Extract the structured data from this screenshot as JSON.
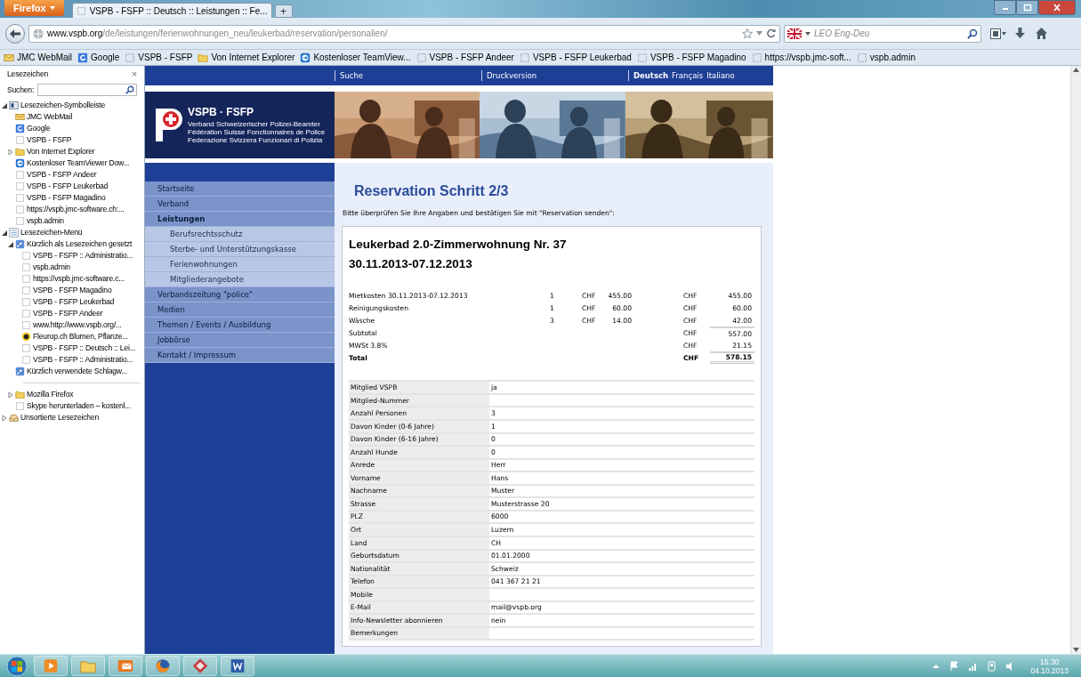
{
  "browser": {
    "menu_button": "Firefox",
    "tabs": [
      {
        "title": "VSPB - FSFP :: Deutsch :: Leistungen :: Fe...",
        "selected": true
      }
    ],
    "new_tab": "+",
    "url": {
      "host": "www.vspb.org",
      "path": "/de/leistungen/ferienwohnungen_neu/leukerbad/reservation/personalien/"
    },
    "search_engine": "LEO Eng-Deu"
  },
  "bookmarks_bar": [
    {
      "label": "JMC WebMail",
      "kind": "mail"
    },
    {
      "label": "Google",
      "kind": "google"
    },
    {
      "label": "VSPB - FSFP",
      "kind": "page"
    },
    {
      "label": "Von Internet Explorer",
      "kind": "folder"
    },
    {
      "label": "Kostenloser TeamView...",
      "kind": "teamviewer"
    },
    {
      "label": "VSPB - FSFP Andeer",
      "kind": "page"
    },
    {
      "label": "VSPB - FSFP Leukerbad",
      "kind": "page"
    },
    {
      "label": "VSPB - FSFP Magadino",
      "kind": "page"
    },
    {
      "label": "https://vspb.jmc-soft...",
      "kind": "page"
    },
    {
      "label": "vspb.admin",
      "kind": "page"
    }
  ],
  "sidebar": {
    "title": "Lesezeichen",
    "close": "×",
    "search_label": "Suchen:",
    "items": [
      {
        "label": "Lesezeichen-Symbolleiste",
        "kind": "toolbar",
        "expanded": true,
        "children": [
          {
            "label": "JMC WebMail",
            "kind": "mail"
          },
          {
            "label": "Google",
            "kind": "google"
          },
          {
            "label": "VSPB - FSFP",
            "kind": "page"
          },
          {
            "label": "Von Internet Explorer",
            "kind": "folder",
            "expanded": false
          },
          {
            "label": "Kostenloser TeamViewer Dow...",
            "kind": "teamviewer"
          },
          {
            "label": "VSPB - FSFP Andeer",
            "kind": "page"
          },
          {
            "label": "VSPB - FSFP Leukerbad",
            "kind": "page"
          },
          {
            "label": "VSPB - FSFP Magadino",
            "kind": "page"
          },
          {
            "label": "https://vspb.jmc-software.ch:...",
            "kind": "page"
          },
          {
            "label": "vspb.admin",
            "kind": "page"
          }
        ]
      },
      {
        "label": "Lesezeichen-Menü",
        "kind": "menu",
        "expanded": true,
        "children": [
          {
            "label": "Kürzlich als Lesezeichen gesetzt",
            "kind": "query",
            "expanded": true,
            "children": [
              {
                "label": "VSPB - FSFP :: Administratio...",
                "kind": "page"
              },
              {
                "label": "vspb.admin",
                "kind": "page"
              },
              {
                "label": "https://vspb.jmc-software.c...",
                "kind": "page"
              },
              {
                "label": "VSPB - FSFP Magadino",
                "kind": "page"
              },
              {
                "label": "VSPB - FSFP Leukerbad",
                "kind": "page"
              },
              {
                "label": "VSPB - FSFP Andeer",
                "kind": "page"
              },
              {
                "label": "www.http://www.vspb.org/...",
                "kind": "page"
              },
              {
                "label": "Fleurop.ch Blumen, Pflanze...",
                "kind": "flower"
              },
              {
                "label": "VSPB - FSFP :: Deutsch :: Lei...",
                "kind": "page"
              },
              {
                "label": "VSPB - FSFP :: Administratio...",
                "kind": "page"
              }
            ]
          },
          {
            "label": "Kürzlich verwendete Schlagw...",
            "kind": "query"
          },
          {
            "kind": "separator"
          },
          {
            "label": "Mozilla Firefox",
            "kind": "folder",
            "expanded": false
          },
          {
            "label": "Skype herunterladen – kostenl...",
            "kind": "page"
          }
        ]
      },
      {
        "label": "Unsortierte Lesezeichen",
        "kind": "unsorted",
        "expanded": false
      }
    ]
  },
  "site": {
    "top_links": [
      "Suche",
      "Druckversion"
    ],
    "languages": [
      {
        "label": "Deutsch",
        "selected": true
      },
      {
        "label": "Français",
        "selected": false
      },
      {
        "label": "Italiano",
        "selected": false
      }
    ],
    "logo": {
      "name": "VSPB · FSFP",
      "lines": [
        "Verband Schweizerischer Polizei-Beamter",
        "Fédération Suisse Fonctionnaires de Police",
        "Federazione Svizzera Funzionari di Polizia"
      ]
    },
    "header_pictures": [
      {
        "kind": "picture"
      },
      {
        "kind": "picture"
      },
      {
        "kind": "picture"
      }
    ],
    "nav": [
      {
        "label": "Startseite",
        "selected": false
      },
      {
        "label": "Verband",
        "selected": false
      },
      {
        "label": "Leistungen",
        "selected": true,
        "children": [
          {
            "label": "Berufsrechtsschutz",
            "selected": false
          },
          {
            "label": "Sterbe- und Unterstützungskasse",
            "selected": false
          },
          {
            "label": "Ferienwohnungen",
            "selected": false
          },
          {
            "label": "Mitgliederangebote",
            "selected": false
          }
        ]
      },
      {
        "label": "Verbandszeitung \"police\"",
        "selected": false
      },
      {
        "label": "Medien",
        "selected": false
      },
      {
        "label": "Themen / Events / Ausbildung",
        "selected": false
      },
      {
        "label": "Jobbörse",
        "selected": false
      },
      {
        "label": "Kontakt / Impressum",
        "selected": false
      }
    ],
    "content": {
      "title": "Reservation Schritt 2/3",
      "intro": "Bitte überprüfen Sie Ihre Angaben und bestätigen Sie mit \"Reservation senden\":",
      "offer_title": "Leukerbad 2.0-Zimmerwohnung Nr. 37",
      "offer_dates": "30.11.2013-07.12.2013",
      "costs": [
        {
          "kind": "item",
          "label": "Mietkosten 30.11.2013-07.12.2013",
          "qty": "1",
          "currency": "CHF",
          "price": "455.00",
          "total_currency": "CHF",
          "amount": "455.00"
        },
        {
          "kind": "item",
          "label": "Reinigungskosten",
          "qty": "1",
          "currency": "CHF",
          "price": "60.00",
          "total_currency": "CHF",
          "amount": "60.00"
        },
        {
          "kind": "item",
          "label": "Wäsche",
          "qty": "3",
          "currency": "CHF",
          "price": "14.00",
          "total_currency": "CHF",
          "amount": "42.00"
        },
        {
          "kind": "subtotal",
          "label": "Subtotal",
          "total_currency": "CHF",
          "amount": "557.00"
        },
        {
          "kind": "tax",
          "label": "MWSt 3.8%",
          "total_currency": "CHF",
          "amount": "21.15"
        },
        {
          "kind": "total",
          "label": "Total",
          "total_currency": "CHF",
          "amount": "578.15"
        }
      ],
      "details": [
        {
          "label": "Mitglied VSPB",
          "value": "ja"
        },
        {
          "label": "Mitglied-Nummer"
        },
        {
          "label": "Anzahl Personen",
          "value": "3"
        },
        {
          "label": "Davon Kinder (0-6 Jahre)",
          "value": "1"
        },
        {
          "label": "Davon Kinder (6-16 Jahre)",
          "value": "0"
        },
        {
          "label": "Anzahl Hunde",
          "value": "0"
        },
        {
          "label": "Anrede",
          "value": "Herr"
        },
        {
          "label": "Vorname",
          "value": "Hans"
        },
        {
          "label": "Nachname",
          "value": "Muster"
        },
        {
          "label": "Strasse",
          "value": "Musterstrasse 20"
        },
        {
          "label": "PLZ",
          "value": "6000"
        },
        {
          "label": "Ort",
          "value": "Luzern"
        },
        {
          "label": "Land",
          "value": "CH"
        },
        {
          "label": "Geburtsdatum",
          "value": "01.01.2000"
        },
        {
          "label": "Nationalität",
          "value": "Schweiz"
        },
        {
          "label": "Telefon",
          "value": "041 367 21 21"
        },
        {
          "label": "Mobile"
        },
        {
          "label": "E-Mail",
          "value": "mail@vspb.org"
        },
        {
          "label": "Info-Newsletter abonnieren",
          "value": "nein"
        },
        {
          "label": "Bemerkungen"
        }
      ]
    }
  },
  "taskbar": {
    "apps": [
      {
        "kind": "player"
      },
      {
        "kind": "explorer"
      },
      {
        "kind": "outlook"
      },
      {
        "kind": "firefox"
      },
      {
        "kind": "paint"
      },
      {
        "kind": "word"
      }
    ],
    "time": "15:30",
    "date": "04.10.2013"
  }
}
